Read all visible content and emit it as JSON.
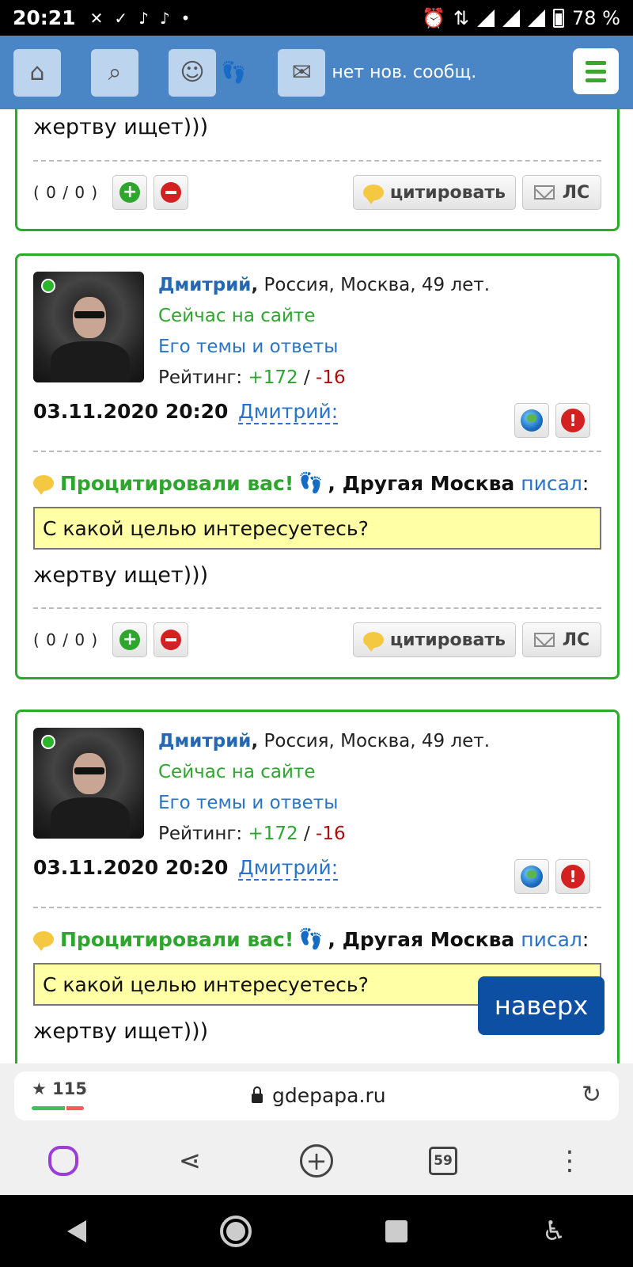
{
  "status": {
    "time": "20:21",
    "battery": "78 %"
  },
  "topbar": {
    "messages_text": "нет нов. сообщ."
  },
  "first_card": {
    "reply_text": "жертву ищет)))",
    "counts": "( 0 / 0 )",
    "quote_label": "цитировать",
    "pm_label": "ЛС"
  },
  "posts": [
    {
      "user_name": "Дмитрий",
      "location": "Россия, Москва, 49 лет.",
      "online_text": "Сейчас на сайте",
      "topics_link": "Его темы и ответы",
      "rating_label": "Рейтинг:",
      "rating_plus": "+172",
      "rating_minus": "-16",
      "date": "03.11.2020 20:20",
      "author_link": "Дмитрий:",
      "quoted_label": "Процитировали вас!",
      "quoted_author": "Другая Москва",
      "wrote": "писал",
      "quote_text": "С какой целью интересуетесь?",
      "reply_text": "жертву ищет)))",
      "counts": "( 0 / 0 )",
      "quote_label": "цитировать",
      "pm_label": "ЛС"
    },
    {
      "user_name": "Дмитрий",
      "location": "Россия, Москва, 49 лет.",
      "online_text": "Сейчас на сайте",
      "topics_link": "Его темы и ответы",
      "rating_label": "Рейтинг:",
      "rating_plus": "+172",
      "rating_minus": "-16",
      "date": "03.11.2020 20:20",
      "author_link": "Дмитрий:",
      "quoted_label": "Процитировали вас!",
      "quoted_author": "Другая Москва",
      "wrote": "писал",
      "quote_text": "С какой целью интересуетесь?",
      "reply_text": "жертву ищет)))"
    }
  ],
  "scroll_top_label": "наверх",
  "browser": {
    "rating": "115",
    "url": "gdepapa.ru",
    "tabs_count": "59"
  }
}
